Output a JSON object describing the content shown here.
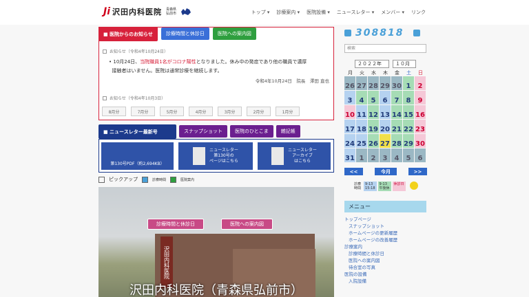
{
  "header": {
    "logo_mark": "Ji",
    "logo_text": "沢田内科医院",
    "logo_sub1": "青森県",
    "logo_sub2": "弘前市",
    "nav": [
      "トップ ▾",
      "診療案内 ▾",
      "医院設備 ▾",
      "ニュースレター ▾",
      "メンバー ▾",
      "リンク"
    ]
  },
  "notice": {
    "tab_main": "■ 医院からのお知らせ",
    "tab_hours": "診療時間と休診日",
    "tab_access": "医院への案内図",
    "item1_head": "お知らせ（令和4年10月24日）",
    "item1_line1_a": "10月24日、",
    "item1_line1_red": "当院職員1名がコロナ陽性",
    "item1_line1_b": "となりました。休み中の発症であり他の職員で濃厚",
    "item1_line2": "接触者はいません。医院は通常診療を継続します。",
    "item1_sign": "令和4年10月24日　院長　澤田 直也",
    "item2_head": "お知らせ（令和4年10月3日）",
    "months": [
      "8月分",
      "7月分",
      "5月分",
      "4月分",
      "3月分",
      "2月分",
      "1月分"
    ]
  },
  "newsletter": {
    "tab_main": "■ ニュースレター最新号",
    "tab_snap": "スナップショット",
    "tab_people": "医院のひとこま",
    "tab_notes": "雑記帳",
    "b1": "第130号PDF（約2,694KB）",
    "b2": "ニュースレター\n第130号の\nページはこちら",
    "b3": "ニュースレター\nアーカイブ\nはこちら"
  },
  "pickup": {
    "label": "ピックアップ",
    "i1": "診療時間",
    "i2": "医院案内"
  },
  "hero": {
    "btn1": "診療時間と休診日",
    "btn2": "医院への案内図",
    "sign": "沢田内科医院",
    "title": "沢田内科医院（青森県弘前市）"
  },
  "sidebar": {
    "counter": "308818",
    "search_placeholder": "検索",
    "year": "２０２２年",
    "month": "１０月",
    "weekdays": [
      "月",
      "火",
      "水",
      "木",
      "金",
      "土",
      "日"
    ],
    "weeks": [
      [
        [
          "26",
          "o"
        ],
        [
          "27",
          "o"
        ],
        [
          "28",
          "o"
        ],
        [
          "29",
          "o"
        ],
        [
          "30",
          "o"
        ],
        [
          "1",
          "g"
        ],
        [
          "2",
          "p"
        ]
      ],
      [
        [
          "3",
          "b"
        ],
        [
          "4",
          "g"
        ],
        [
          "5",
          "g"
        ],
        [
          "6",
          "b"
        ],
        [
          "7",
          "g"
        ],
        [
          "8",
          "g"
        ],
        [
          "9",
          "p"
        ]
      ],
      [
        [
          "10",
          "p"
        ],
        [
          "11",
          "b"
        ],
        [
          "12",
          "g"
        ],
        [
          "13",
          "b"
        ],
        [
          "14",
          "g"
        ],
        [
          "15",
          "g"
        ],
        [
          "16",
          "p"
        ]
      ],
      [
        [
          "17",
          "b"
        ],
        [
          "18",
          "b"
        ],
        [
          "19",
          "g"
        ],
        [
          "20",
          "b"
        ],
        [
          "21",
          "g"
        ],
        [
          "22",
          "g"
        ],
        [
          "23",
          "p"
        ]
      ],
      [
        [
          "24",
          "b"
        ],
        [
          "25",
          "b"
        ],
        [
          "26",
          "g"
        ],
        [
          "27",
          "t"
        ],
        [
          "28",
          "g"
        ],
        [
          "29",
          "g"
        ],
        [
          "30",
          "p"
        ]
      ],
      [
        [
          "31",
          "b"
        ],
        [
          "1",
          "o"
        ],
        [
          "2",
          "o"
        ],
        [
          "3",
          "o"
        ],
        [
          "4",
          "o"
        ],
        [
          "5",
          "o"
        ],
        [
          "6",
          "o"
        ]
      ]
    ],
    "prev": "<<",
    "today": "今月",
    "next": ">>",
    "legend": [
      "診療\n時間",
      "9-13\n15-18",
      "9-13\n午後休",
      "休診日"
    ],
    "menu_title": "メニュー",
    "menu": [
      [
        "トップページ",
        0
      ],
      [
        "スナップショット",
        1
      ],
      [
        "ホームページの更新履歴",
        1
      ],
      [
        "ホームページの改善履歴",
        1
      ],
      [
        "診療案内",
        0
      ],
      [
        "診療時間と休診日",
        1
      ],
      [
        "医院への案内図",
        1
      ],
      [
        "待合室の写真",
        1
      ],
      [
        "医院の設備",
        0
      ],
      [
        "入院設備",
        1
      ]
    ]
  },
  "colors": {
    "accent_red": "#d7213b",
    "accent_navy": "#1c3a8c"
  }
}
